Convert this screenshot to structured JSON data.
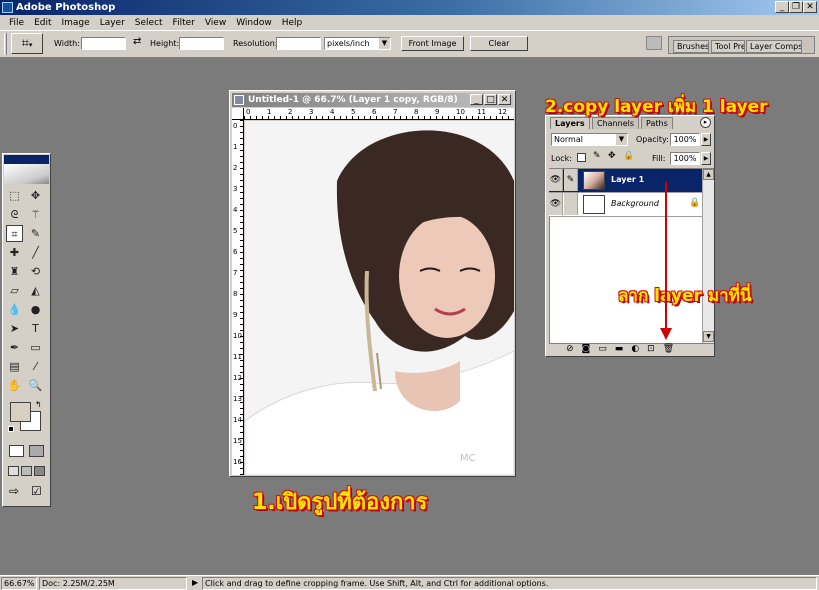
{
  "window": {
    "title": "Adobe Photoshop"
  },
  "menu": [
    "File",
    "Edit",
    "Image",
    "Layer",
    "Select",
    "Filter",
    "View",
    "Window",
    "Help"
  ],
  "options": {
    "width_label": "Width:",
    "height_label": "Height:",
    "resolution_label": "Resolution:",
    "units": "pixels/inch",
    "front_image": "Front Image",
    "clear": "Clear"
  },
  "palette_well": [
    "Brushes",
    "Tool Pre",
    "Layer Comps"
  ],
  "document": {
    "title": "Untitled-1 @ 66.7% (Layer 1 copy, RGB/8)",
    "ruler_top": [
      "0",
      "1",
      "2",
      "3",
      "4",
      "5",
      "6",
      "7",
      "8",
      "9",
      "10",
      "11",
      "12"
    ],
    "ruler_left": [
      "0",
      "1",
      "2",
      "3",
      "4",
      "5",
      "6",
      "7",
      "8",
      "9",
      "10",
      "11",
      "12",
      "13",
      "14",
      "15",
      "16"
    ]
  },
  "layers_panel": {
    "tabs": [
      "Layers",
      "Channels",
      "Paths"
    ],
    "blend_mode": "Normal",
    "opacity_label": "Opacity:",
    "opacity": "100%",
    "lock_label": "Lock:",
    "fill_label": "Fill:",
    "fill": "100%",
    "layers": [
      {
        "name": "Layer 1",
        "selected": true
      },
      {
        "name": "Background",
        "selected": false
      }
    ]
  },
  "annotations": {
    "step1": "1.เปิดรูปที่ต้องการ",
    "step2": "2.copy layer เพิ่ม 1 layer",
    "drag": "ลาก layer มาที่นี่"
  },
  "status": {
    "zoom": "66.67%",
    "doc": "Doc: 2.25M/2.25M",
    "hint": "Click and drag to define cropping frame. Use Shift, Alt, and Ctrl for additional options."
  },
  "colors": {
    "selection": "#0a246a",
    "annotation_text": "#ffe400",
    "annotation_outline": "#d01010",
    "arrow": "#d00000"
  }
}
